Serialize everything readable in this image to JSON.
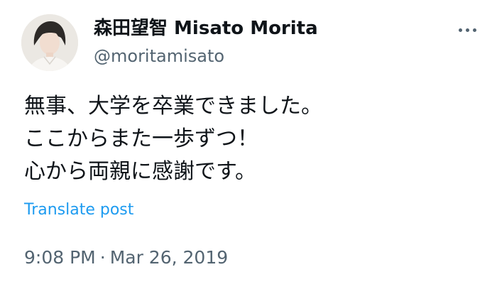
{
  "tweet": {
    "author": {
      "display_name": "森田望智 Misato Morita",
      "handle": "@moritamisato",
      "avatar_icon": "profile-photo"
    },
    "more_icon": "more-dots-icon",
    "text_lines": [
      "無事、大学を卒業できました。",
      "ここからまた一歩ずつ！",
      "心から両親に感謝です。"
    ],
    "translate_label": "Translate post",
    "time": "9:08 PM",
    "separator": "·",
    "date": "Mar 26, 2019",
    "colors": {
      "text": "#0f1419",
      "secondary": "#536471",
      "link": "#1d9bf0"
    }
  }
}
